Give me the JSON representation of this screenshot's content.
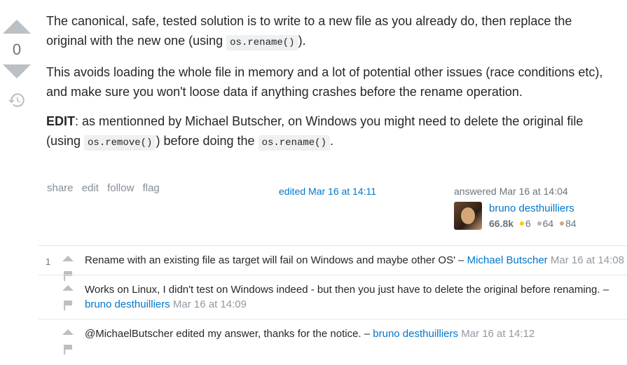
{
  "vote": {
    "count": "0"
  },
  "post": {
    "p1_a": "The canonical, safe, tested solution is to write to a new file as you already do, then replace the original with the new one (using ",
    "p1_code": "os.rename()",
    "p1_b": ").",
    "p2": "This avoids loading the whole file in memory and a lot of potential other issues (race conditions etc), and make sure you won't loose data if anything crashes before the rename operation.",
    "p3_bold": "EDIT",
    "p3_a": ": as mentionned by Michael Butscher, on Windows you might need to delete the original file (using ",
    "p3_code1": "os.remove()",
    "p3_b": ") before doing the ",
    "p3_code2": "os.rename()",
    "p3_c": "."
  },
  "menu": {
    "share": "share",
    "edit": "edit",
    "follow": "follow",
    "flag": "flag"
  },
  "edited": "edited Mar 16 at 14:11",
  "answered": "answered Mar 16 at 14:04",
  "user": {
    "name": "bruno desthuilliers",
    "reputation": "66.8k",
    "gold": "6",
    "silver": "64",
    "bronze": "84",
    "badge_colors": {
      "gold": "#ffcc01",
      "silver": "#b4b8bc",
      "bronze": "#d1a684"
    }
  },
  "comments": [
    {
      "score": "1",
      "text": "Rename with an existing file as target will fail on Windows and maybe other OS' – ",
      "user": "Michael Butscher",
      "date": "Mar 16 at 14:08"
    },
    {
      "score": "",
      "text": "Works on Linux, I didn't test on Windows indeed - but then you just have to delete the original before renaming. – ",
      "user": "bruno desthuilliers",
      "date": "Mar 16 at 14:09"
    },
    {
      "score": "",
      "text": "@MichaelButscher edited my answer, thanks for the notice. – ",
      "user": "bruno desthuilliers",
      "date": "Mar 16 at 14:12"
    }
  ]
}
